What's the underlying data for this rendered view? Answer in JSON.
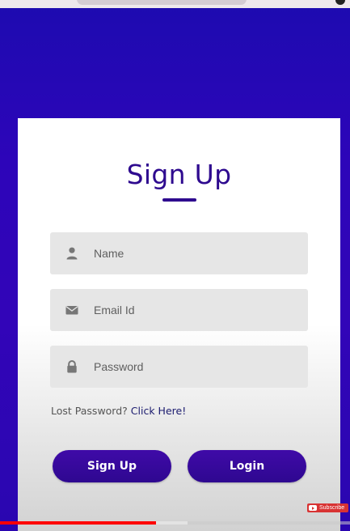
{
  "form": {
    "title": "Sign Up",
    "fields": [
      {
        "name": "name",
        "placeholder": "Name",
        "icon": "user-icon"
      },
      {
        "name": "email",
        "placeholder": "Email Id",
        "icon": "envelope-icon"
      },
      {
        "name": "password",
        "placeholder": "Password",
        "icon": "lock-icon"
      }
    ],
    "lost_password_text": "Lost Password?",
    "lost_password_link": "Click Here!",
    "buttons": {
      "signup_label": "Sign Up",
      "login_label": "Login"
    }
  },
  "video_player": {
    "subscribe_label": "Subscribe",
    "progress_played": 0.445,
    "progress_buffered": 0.535
  },
  "colors": {
    "background": "#2d05b9",
    "accent": "#2e0a8f",
    "button": "#3a0aa0",
    "field_background": "#e6e6e6",
    "progress": "#ff0000"
  }
}
